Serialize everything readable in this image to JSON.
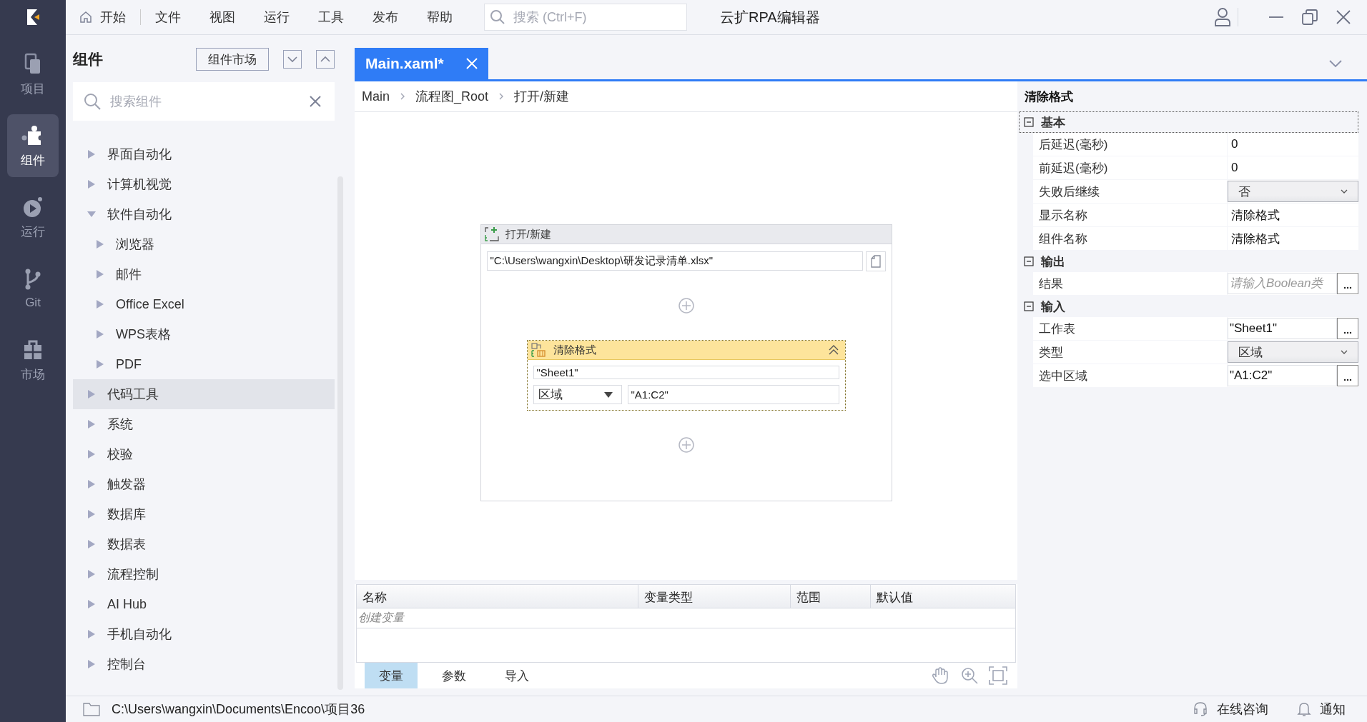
{
  "app": {
    "title": "云扩RPA编辑器"
  },
  "menu": [
    {
      "label": "开始",
      "kind": "home"
    },
    {
      "label": "文件",
      "kind": "plain"
    },
    {
      "label": "视图",
      "kind": "plain"
    },
    {
      "label": "运行",
      "kind": "plain"
    },
    {
      "label": "工具",
      "kind": "plain"
    },
    {
      "label": "发布",
      "kind": "plain"
    },
    {
      "label": "帮助",
      "kind": "plain"
    }
  ],
  "search": {
    "placeholder": "搜索 (Ctrl+F)"
  },
  "nav": [
    {
      "label": "项目",
      "kind": "project",
      "selected": false
    },
    {
      "label": "组件",
      "kind": "component",
      "selected": true
    },
    {
      "label": "运行",
      "kind": "run",
      "selected": false
    },
    {
      "label": "Git",
      "kind": "git",
      "selected": false
    },
    {
      "label": "市场",
      "kind": "market",
      "selected": false
    }
  ],
  "components": {
    "title": "组件",
    "market_button": "组件市场",
    "search_placeholder": "搜索组件",
    "tree": [
      {
        "label": "界面自动化",
        "expanded": false,
        "selected": false
      },
      {
        "label": "计算机视觉",
        "expanded": false,
        "selected": false
      },
      {
        "label": "软件自动化",
        "expanded": true,
        "selected": false,
        "children": [
          {
            "label": "浏览器",
            "expanded": false,
            "selected": false
          },
          {
            "label": "邮件",
            "expanded": false,
            "selected": false
          },
          {
            "label": "Office Excel",
            "expanded": false,
            "selected": false
          },
          {
            "label": "WPS表格",
            "expanded": false,
            "selected": false
          },
          {
            "label": "PDF",
            "expanded": false,
            "selected": false
          }
        ]
      },
      {
        "label": "代码工具",
        "expanded": false,
        "selected": true
      },
      {
        "label": "系统",
        "expanded": false,
        "selected": false
      },
      {
        "label": "校验",
        "expanded": false,
        "selected": false
      },
      {
        "label": "触发器",
        "expanded": false,
        "selected": false
      },
      {
        "label": "数据库",
        "expanded": false,
        "selected": false
      },
      {
        "label": "数据表",
        "expanded": false,
        "selected": false
      },
      {
        "label": "流程控制",
        "expanded": false,
        "selected": false
      },
      {
        "label": "AI Hub",
        "expanded": false,
        "selected": false
      },
      {
        "label": "手机自动化",
        "expanded": false,
        "selected": false
      },
      {
        "label": "控制台",
        "expanded": false,
        "selected": false
      }
    ]
  },
  "tabs": [
    {
      "label": "Main.xaml*",
      "selected": true
    }
  ],
  "breadcrumb": [
    "Main",
    "流程图_Root",
    "打开/新建"
  ],
  "canvas": {
    "scope": {
      "title": "打开/新建",
      "path": "\"C:\\Users\\wangxin\\Desktop\\研发记录清单.xlsx\"",
      "activity": {
        "title": "清除格式",
        "selected": true,
        "sheet": "\"Sheet1\"",
        "type": "区域",
        "range": "\"A1:C2\""
      }
    }
  },
  "variables": {
    "columns": [
      "名称",
      "变量类型",
      "范围",
      "默认值"
    ],
    "placeholder": "创建变量",
    "tabs": [
      {
        "label": "变量",
        "selected": true
      },
      {
        "label": "参数",
        "selected": false
      },
      {
        "label": "导入",
        "selected": false
      }
    ]
  },
  "properties": {
    "title": "清除格式",
    "sections": [
      {
        "name": "基本",
        "expanded": true,
        "focused": true,
        "rows": [
          {
            "label": "后延迟(毫秒)",
            "kind": "text",
            "value": "0"
          },
          {
            "label": "前延迟(毫秒)",
            "kind": "text",
            "value": "0"
          },
          {
            "label": "失败后继续",
            "kind": "dropdown",
            "value": "否"
          },
          {
            "label": "显示名称",
            "kind": "text",
            "value": "清除格式"
          },
          {
            "label": "组件名称",
            "kind": "text",
            "value": "清除格式"
          }
        ]
      },
      {
        "name": "输出",
        "expanded": true,
        "focused": false,
        "rows": [
          {
            "label": "结果",
            "kind": "input",
            "placeholder": "请输入Boolean类"
          }
        ]
      },
      {
        "name": "输入",
        "expanded": true,
        "focused": false,
        "rows": [
          {
            "label": "工作表",
            "kind": "input",
            "value": "\"Sheet1\""
          },
          {
            "label": "类型",
            "kind": "dropdown",
            "value": "区域"
          },
          {
            "label": "选中区域",
            "kind": "input",
            "value": "\"A1:C2\""
          }
        ]
      }
    ]
  },
  "status_bar": {
    "path": "C:\\Users\\wangxin\\Documents\\Encoo\\项目36",
    "consult": "在线咨询",
    "notify": "通知"
  }
}
